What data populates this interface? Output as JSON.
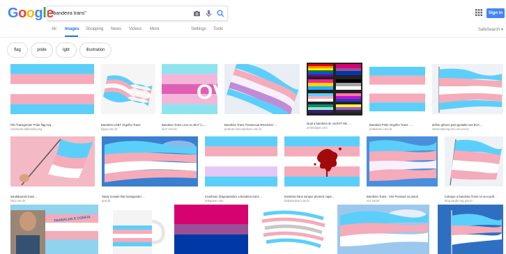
{
  "header": {
    "logo_letters": [
      "G",
      "o",
      "o",
      "g",
      "l",
      "e"
    ],
    "logo_colors": [
      "#4285f4",
      "#ea4335",
      "#fbbc05",
      "#4285f4",
      "#34a853",
      "#ea4335"
    ],
    "search_value": "\"bandeira trans\"",
    "signin_label": "Sign in",
    "accent": "#4285f4"
  },
  "tabs": {
    "items": [
      "All",
      "Images",
      "Shopping",
      "News",
      "Videos",
      "More",
      "Settings",
      "Tools"
    ],
    "active": "Images",
    "safesearch": "SafeSearch ▾"
  },
  "chips": [
    "flag",
    "pride",
    "lgbt",
    "illustration"
  ],
  "results": [
    {
      "title": "File:Transgender Pride flag.svg ...",
      "domain": "commons.wikimedia.org"
    },
    {
      "title": "Bandeira LGBT Orgulho Trans",
      "domain": "kigay.com.br"
    },
    {
      "title": "Bandeira Trans Love no Elo7 | L...",
      "domain": "elo7.com.br"
    },
    {
      "title": "Bandeira Trans Transexual 90x140cm ...",
      "domain": "produto.mercadolivre.com.br"
    },
    {
      "title": "Qual a bandeira de vocês?! Me ...",
      "domain": "aminoapps.com"
    },
    {
      "title": "Bandeira Pride Orgulho Trans - ...",
      "domain": "pridestore.com.br"
    },
    {
      "title": "define gênero pela gestalta nos EUA ...",
      "domain": "observatoriog.bol.uol.com.br"
    },
    {
      "title": "sandalaurais trans ...",
      "domain": "fairy.com.br"
    },
    {
      "title": "Study reveals that transgender ...",
      "domain": "pnw.pt"
    },
    {
      "title": "mouthsan @agnatambre a bandeira trans ...",
      "domain": "artsqueer.com"
    },
    {
      "title": "bandeira trans sangue phoenix capa ...",
      "domain": "bellasonline.com.br"
    },
    {
      "title": "Bandeira Trans - Vós Pessoas no plural",
      "domain": "voz.social"
    },
    {
      "title": "Coloque a bandeira Trans no seu perfi...",
      "domain": "blog.saude.mg.gov.br"
    },
    {
      "banner": "TRABALHA E CONFIA"
    }
  ]
}
